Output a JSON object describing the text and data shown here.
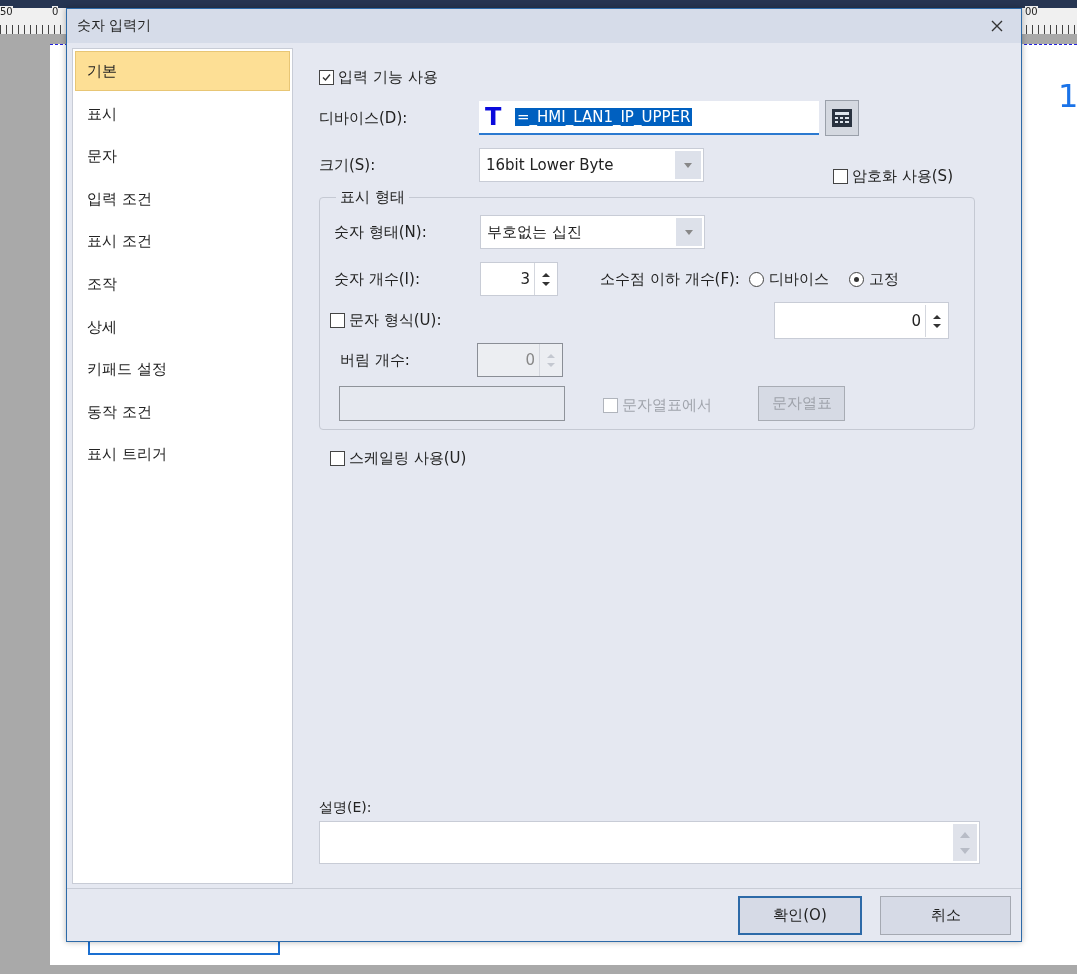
{
  "ruler": {
    "labels": [
      "50",
      "0",
      "00"
    ]
  },
  "background": {
    "value_text": "1"
  },
  "window": {
    "title": "숫자 입력기"
  },
  "sidebar": {
    "items": [
      {
        "label": "기본",
        "selected": true
      },
      {
        "label": "표시",
        "selected": false
      },
      {
        "label": "문자",
        "selected": false
      },
      {
        "label": "입력 조건",
        "selected": false
      },
      {
        "label": "표시 조건",
        "selected": false
      },
      {
        "label": "조작",
        "selected": false
      },
      {
        "label": "상세",
        "selected": false
      },
      {
        "label": "키패드 설정",
        "selected": false
      },
      {
        "label": "동작 조건",
        "selected": false
      },
      {
        "label": "표시 트리거",
        "selected": false
      }
    ]
  },
  "enable_input": {
    "label": "입력 기능 사용",
    "checked": true
  },
  "device": {
    "label": "디바이스(D):",
    "type_glyph": "T",
    "value": "=_HMI_LAN1_IP_UPPER"
  },
  "size": {
    "label": "크기(S):",
    "value": "16bit Lower Byte"
  },
  "encrypt": {
    "label": "암호화 사용(S)",
    "checked": false
  },
  "display_format": {
    "title": "표시 형태",
    "number_type": {
      "label": "숫자 형태(N):",
      "value": "부호없는 십진"
    },
    "digits": {
      "label": "숫자 개수(I):",
      "value": "3"
    },
    "decimals": {
      "label": "소수점 이하 개수(F):",
      "value": "0",
      "options": [
        {
          "label": "디바이스",
          "selected": false
        },
        {
          "label": "고정",
          "selected": true
        }
      ]
    },
    "char_format": {
      "label": "문자 형식(U):",
      "checked": false
    },
    "truncate": {
      "label": "버림 개수:",
      "value": "0",
      "disabled": true
    },
    "text_field": {
      "disabled": true
    },
    "string_table_check": {
      "label": "문자열표에서",
      "checked": false,
      "disabled": true
    },
    "string_table_button": {
      "label": "문자열표",
      "disabled": true
    }
  },
  "scaling": {
    "label": "스케일링 사용(U)",
    "checked": false
  },
  "description": {
    "label": "설명(E):"
  },
  "buttons": [
    {
      "label": "확인(O)",
      "default": true
    },
    {
      "label": "취소",
      "default": false
    }
  ]
}
